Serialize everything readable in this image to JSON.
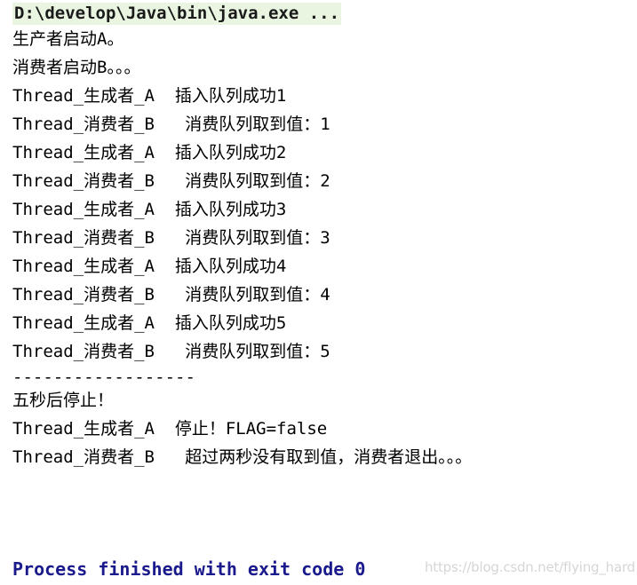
{
  "console": {
    "command_line": "D:\\develop\\Java\\bin\\java.exe ...",
    "highlight_color": "#e9f5e1",
    "text_color": "#000000",
    "exit_color": "#1a1a8c",
    "background_color": "#ffffff",
    "lines": [
      {
        "text": "生产者启动A。",
        "kind": "output"
      },
      {
        "text": "消费者启动B。。。",
        "kind": "output"
      },
      {
        "text": "Thread_生成者_A  插入队列成功1",
        "kind": "output"
      },
      {
        "text": "Thread_消费者_B   消费队列取到值：1",
        "kind": "output"
      },
      {
        "text": "Thread_生成者_A  插入队列成功2",
        "kind": "output"
      },
      {
        "text": "Thread_消费者_B   消费队列取到值：2",
        "kind": "output"
      },
      {
        "text": "Thread_生成者_A  插入队列成功3",
        "kind": "output"
      },
      {
        "text": "Thread_消费者_B   消费队列取到值：3",
        "kind": "output"
      },
      {
        "text": "Thread_生成者_A  插入队列成功4",
        "kind": "output"
      },
      {
        "text": "Thread_消费者_B   消费队列取到值：4",
        "kind": "output"
      },
      {
        "text": "Thread_生成者_A  插入队列成功5",
        "kind": "output"
      },
      {
        "text": "Thread_消费者_B   消费队列取到值：5",
        "kind": "output"
      },
      {
        "text": "------------------",
        "kind": "separator"
      },
      {
        "text": "五秒后停止！",
        "kind": "output"
      },
      {
        "text": "Thread_生成者_A  停止！FLAG=false",
        "kind": "output"
      },
      {
        "text": "Thread_消费者_B   超过两秒没有取到值，消费者退出。。。",
        "kind": "output"
      }
    ],
    "exit_message": "Process finished with exit code 0",
    "watermark": "https://blog.csdn.net/flying_hard"
  }
}
